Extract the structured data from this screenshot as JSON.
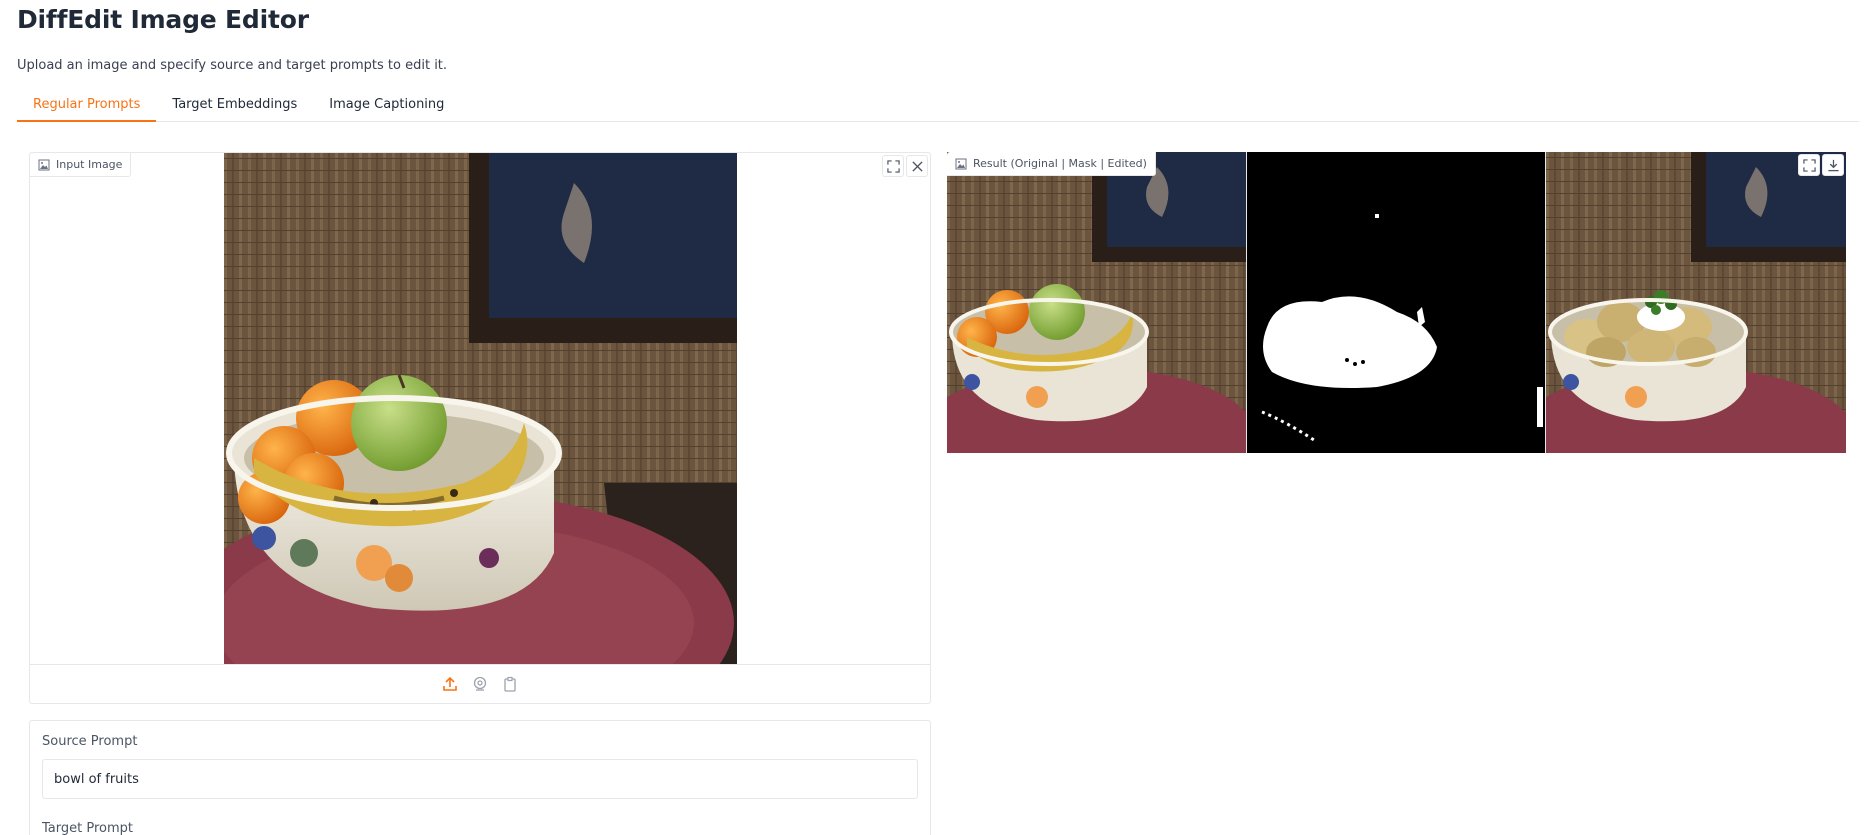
{
  "app": {
    "title": "DiffEdit Image Editor",
    "subtitle": "Upload an image and specify source and target prompts to edit it."
  },
  "tabs": [
    {
      "label": "Regular Prompts",
      "active": true
    },
    {
      "label": "Target Embeddings",
      "active": false
    },
    {
      "label": "Image Captioning",
      "active": false
    }
  ],
  "input_panel": {
    "label": "Input Image",
    "image_description_icon": "image-icon",
    "buttons": [
      "fullscreen-icon",
      "close-icon"
    ],
    "toolbar": [
      "upload-icon",
      "webcam-icon",
      "clipboard-icon"
    ]
  },
  "result_panel": {
    "label": "Result (Original | Mask | Edited)",
    "buttons": [
      "fullscreen-icon",
      "download-icon"
    ]
  },
  "prompts": {
    "source_label": "Source Prompt",
    "source_value": "bowl of fruits",
    "target_label": "Target Prompt"
  },
  "colors": {
    "accent": "#f97316",
    "border": "#e5e7eb"
  }
}
